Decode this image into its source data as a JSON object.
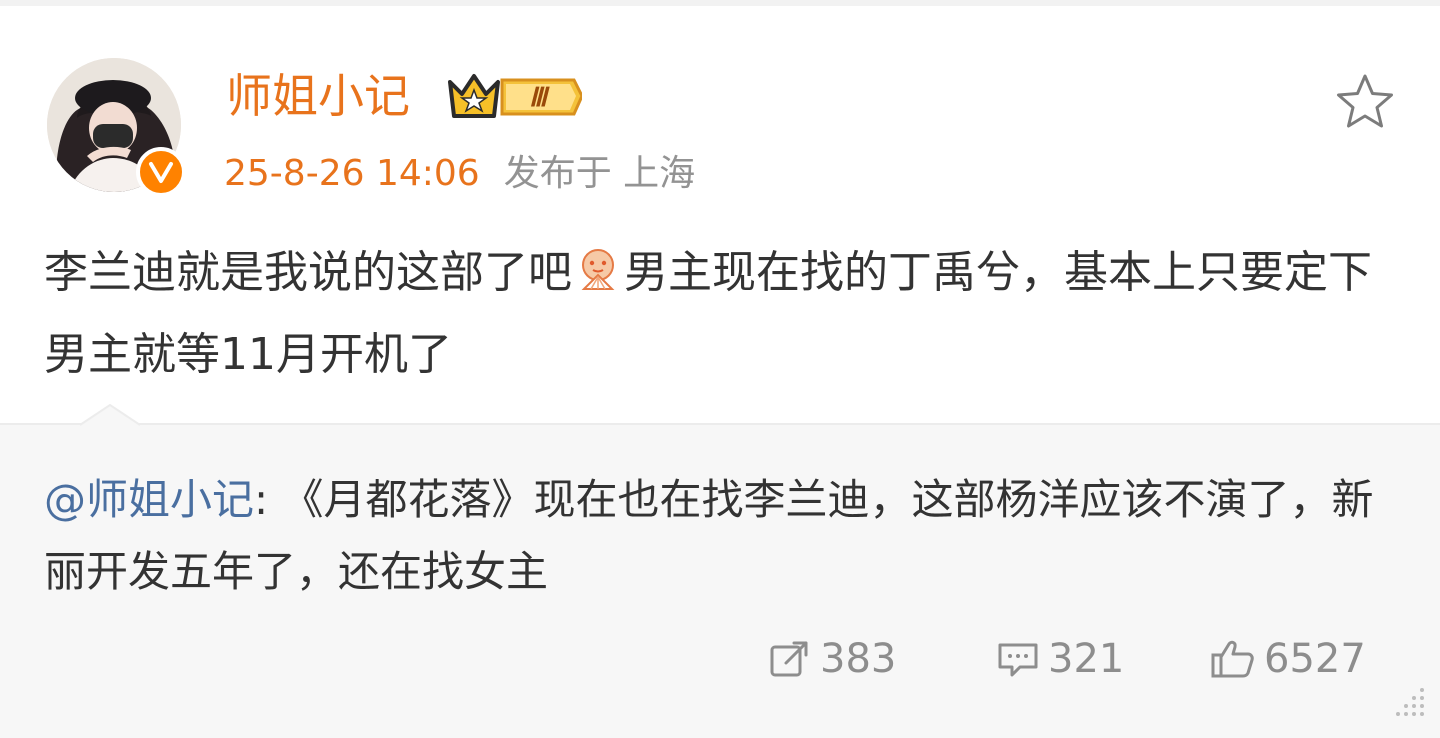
{
  "post": {
    "author": {
      "name": "师姐小记",
      "level_badge": "Ⅲ",
      "verified": true
    },
    "meta": {
      "timestamp": "25-8-26 14:06",
      "location": "发布于 上海"
    },
    "text_part1": "李兰迪就是我说的这部了吧",
    "emoji": "fan-emoji",
    "text_part2": "男主现在找的丁禹兮，基本上只要定下男主就等11月开机了"
  },
  "repost": {
    "mention": "@师姐小记",
    "separator": ":",
    "text": " 《月都花落》现在也在找李兰迪，这部杨洋应该不演了，新丽开发五年了，还在找女主"
  },
  "actions": {
    "repost_count": "383",
    "comment_count": "321",
    "like_count": "6527"
  },
  "colors": {
    "accent_orange": "#e8731c",
    "mention_blue": "#4a6fa0",
    "verified_badge": "#ff8200",
    "repost_bg": "#f7f7f7"
  },
  "icons": [
    "star-icon",
    "repost-icon",
    "comment-icon",
    "like-icon",
    "verified-icon",
    "crown-icon"
  ]
}
